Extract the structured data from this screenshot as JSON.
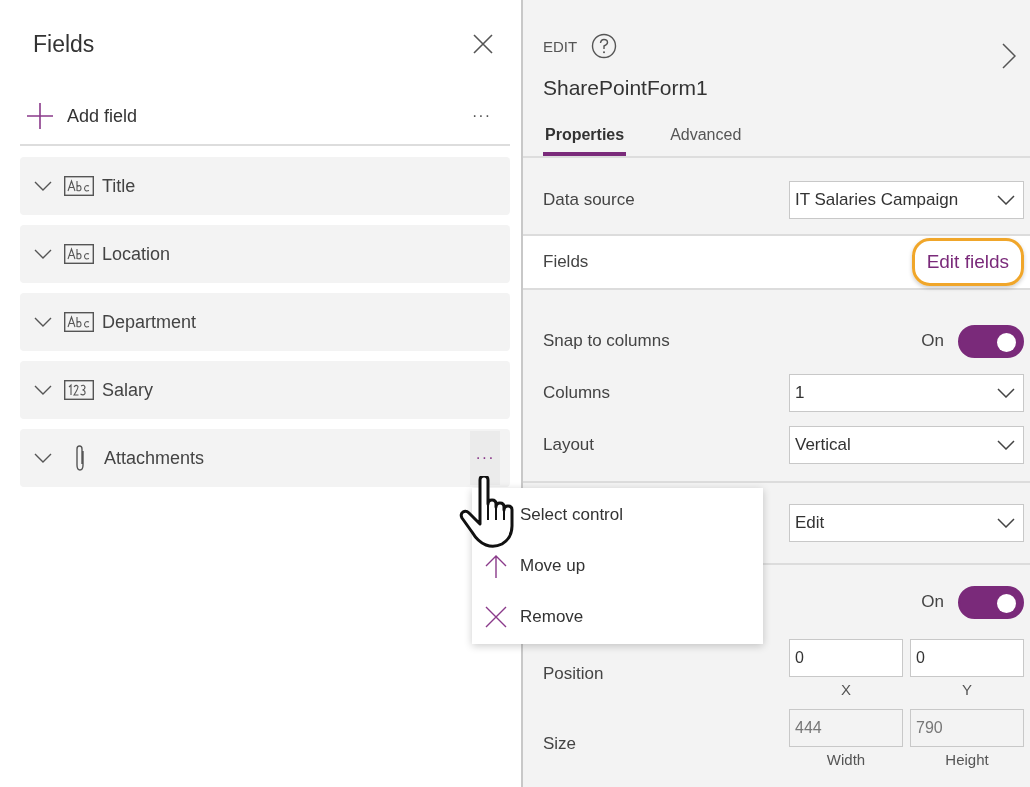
{
  "fields_panel": {
    "title": "Fields",
    "add_field": "Add field",
    "more": "···",
    "fields": [
      {
        "name": "Title",
        "kind": "text",
        "show_more": false
      },
      {
        "name": "Location",
        "kind": "text",
        "show_more": false
      },
      {
        "name": "Department",
        "kind": "text",
        "show_more": false
      },
      {
        "name": "Salary",
        "kind": "number",
        "show_more": false
      },
      {
        "name": "Attachments",
        "kind": "attachment",
        "show_more": true
      }
    ]
  },
  "context_menu": {
    "items": [
      {
        "label": "Select control",
        "kind": "select"
      },
      {
        "label": "Move up",
        "kind": "move"
      },
      {
        "label": "Remove",
        "kind": "remove"
      }
    ]
  },
  "properties_panel": {
    "mode": "EDIT",
    "control_name": "SharePointForm1",
    "tabs": [
      {
        "label": "Properties",
        "selected": true
      },
      {
        "label": "Advanced",
        "selected": false
      }
    ],
    "sections": [
      {
        "rows": [
          {
            "kind": "dropdown",
            "label": "Data source",
            "value": "IT Salaries Campaign"
          }
        ]
      },
      {
        "white": true,
        "rows": [
          {
            "kind": "link",
            "label": "Fields",
            "value": "Edit fields",
            "highlighted": true
          }
        ]
      },
      {
        "rows": [
          {
            "kind": "toggle",
            "label": "Snap to columns",
            "value": "On",
            "on": true
          },
          {
            "kind": "dropdown",
            "label": "Columns",
            "value": "1"
          },
          {
            "kind": "dropdown",
            "label": "Layout",
            "value": "Vertical"
          }
        ]
      },
      {
        "rows": [
          {
            "kind": "dropdown",
            "value": "Edit"
          }
        ]
      },
      {
        "rows": [
          {
            "kind": "toggle",
            "value": "On",
            "on": true
          },
          {
            "kind": "pair",
            "label": "Position",
            "values": [
              "0",
              "0"
            ],
            "captions": [
              "X",
              "Y"
            ],
            "disabled": false
          },
          {
            "kind": "pair",
            "label": "Size",
            "values": [
              "444",
              "790"
            ],
            "captions": [
              "Width",
              "Height"
            ],
            "disabled": true
          }
        ]
      }
    ]
  }
}
